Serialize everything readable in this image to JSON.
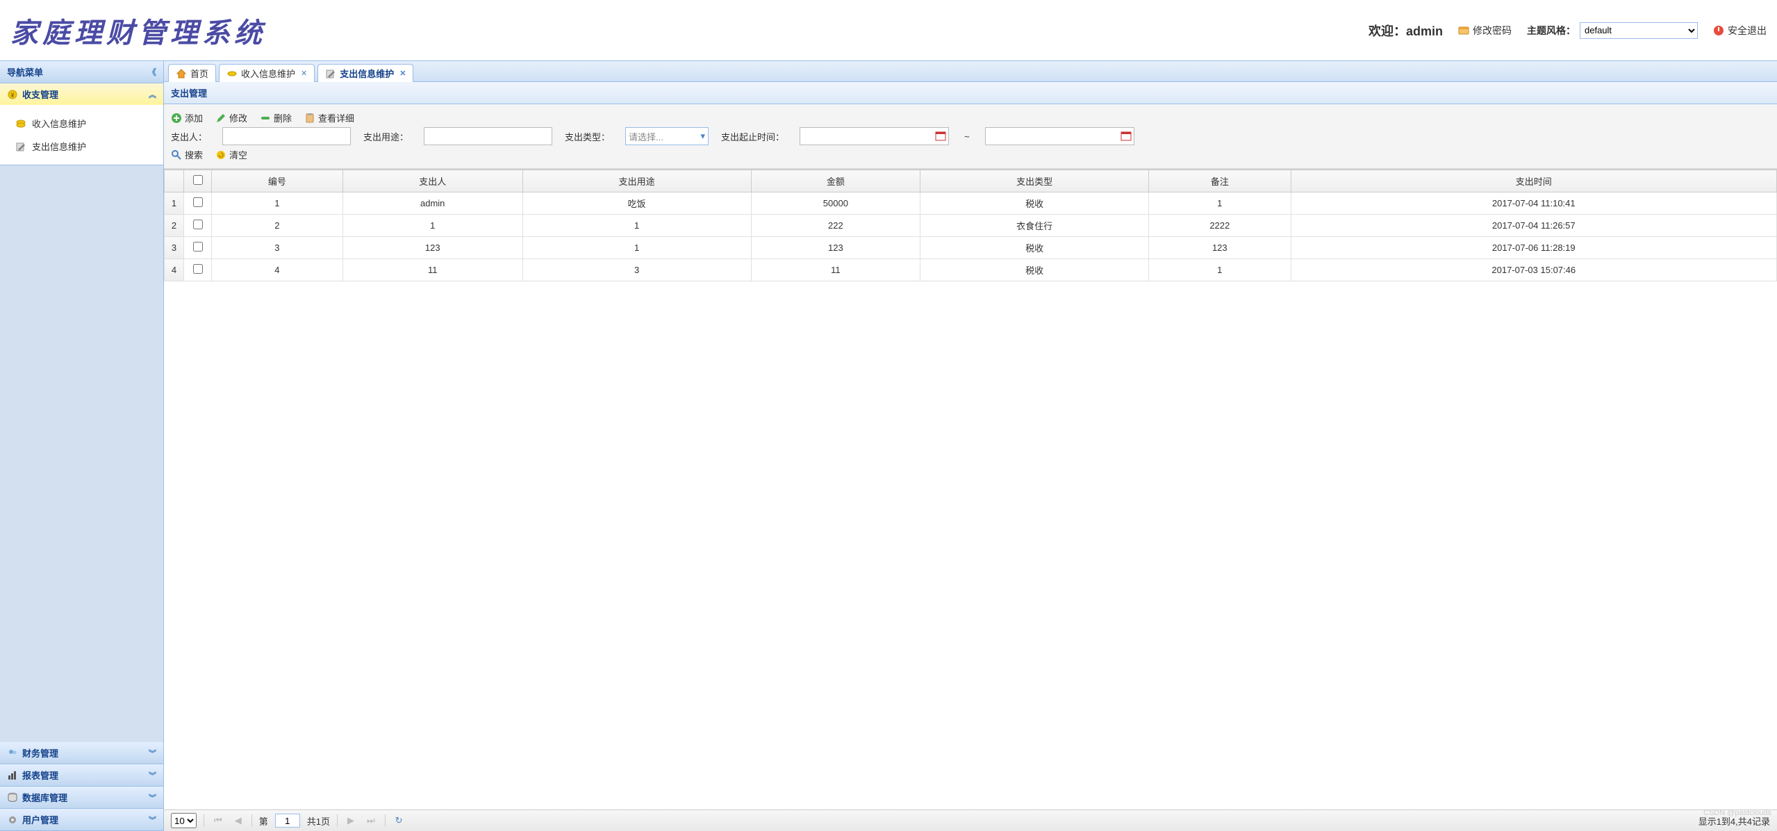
{
  "header": {
    "app_title": "家庭理财管理系统",
    "welcome_prefix": "欢迎：",
    "username": "admin",
    "change_password": "修改密码",
    "theme_label": "主题风格：",
    "theme_value": "default",
    "logout": "安全退出"
  },
  "sidebar": {
    "title": "导航菜单",
    "panels": [
      {
        "title": "收支管理",
        "expanded": true,
        "items": [
          {
            "label": "收入信息维护"
          },
          {
            "label": "支出信息维护"
          }
        ]
      },
      {
        "title": "财务管理",
        "expanded": false
      },
      {
        "title": "报表管理",
        "expanded": false
      },
      {
        "title": "数据库管理",
        "expanded": false
      },
      {
        "title": "用户管理",
        "expanded": false
      }
    ]
  },
  "tabs": [
    {
      "label": "首页",
      "closable": false
    },
    {
      "label": "收入信息维护",
      "closable": true
    },
    {
      "label": "支出信息维护",
      "closable": true,
      "active": true
    }
  ],
  "panel": {
    "title": "支出管理",
    "toolbar": {
      "add": "添加",
      "edit": "修改",
      "delete": "删除",
      "detail": "查看详细",
      "search": "搜索",
      "clear": "清空",
      "person_label": "支出人：",
      "purpose_label": "支出用途：",
      "type_label": "支出类型：",
      "type_placeholder": "请选择...",
      "daterange_label": "支出起止时间：",
      "tilde": "~"
    }
  },
  "grid": {
    "columns": [
      "编号",
      "支出人",
      "支出用途",
      "金额",
      "支出类型",
      "备注",
      "支出时间"
    ],
    "rows": [
      [
        "1",
        "admin",
        "吃饭",
        "50000",
        "税收",
        "1",
        "2017-07-04 11:10:41"
      ],
      [
        "2",
        "1",
        "1",
        "222",
        "衣食住行",
        "2222",
        "2017-07-04 11:26:57"
      ],
      [
        "3",
        "123",
        "1",
        "123",
        "税收",
        "123",
        "2017-07-06 11:28:19"
      ],
      [
        "4",
        "11",
        "3",
        "11",
        "税收",
        "1",
        "2017-07-03 15:07:46"
      ]
    ]
  },
  "pager": {
    "page_size": "10",
    "page_prefix": "第",
    "page_value": "1",
    "page_total": "共1页",
    "info": "显示1到4,共4记录"
  },
  "watermark": "CSDN @pastclouds"
}
